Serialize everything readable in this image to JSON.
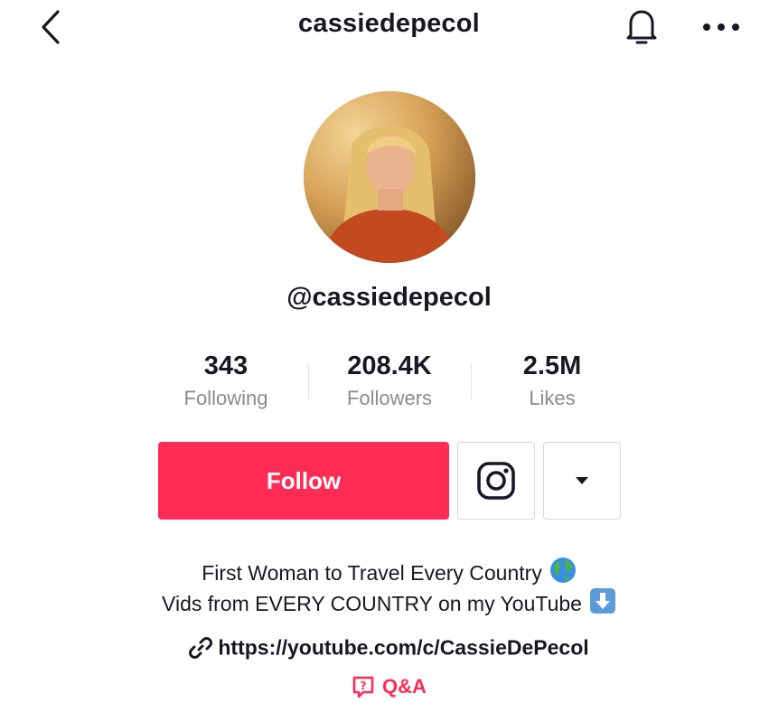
{
  "header": {
    "title": "cassiedepecol"
  },
  "profile": {
    "handle": "@cassiedepecol",
    "stats": [
      {
        "value": "343",
        "label": "Following"
      },
      {
        "value": "208.4K",
        "label": "Followers"
      },
      {
        "value": "2.5M",
        "label": "Likes"
      }
    ]
  },
  "actions": {
    "follow_label": "Follow"
  },
  "bio": {
    "line1": "First Woman to Travel Every Country",
    "line2": "Vids from EVERY COUNTRY on my YouTube"
  },
  "link": {
    "url": "https://youtube.com/c/CassieDePecol"
  },
  "qa": {
    "label": "Q&A"
  },
  "colors": {
    "accent": "#fe2c55",
    "text": "#161823",
    "muted": "#8a8b91"
  },
  "icons": [
    "chevron-left-icon",
    "bell-icon",
    "more-icon",
    "instagram-icon",
    "caret-down-icon",
    "globe-icon",
    "down-arrow-icon",
    "link-icon",
    "qa-icon"
  ]
}
